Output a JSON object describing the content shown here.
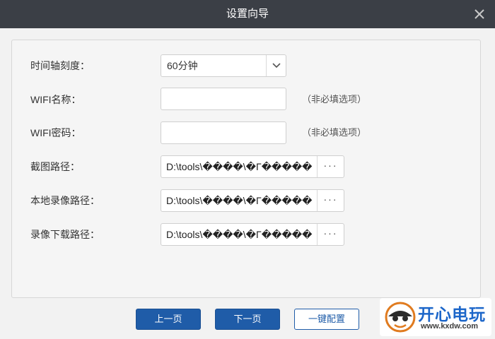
{
  "window": {
    "title": "设置向导"
  },
  "form": {
    "timeline_label": "时间轴刻度：",
    "timeline_value": "60分钟",
    "wifi_name_label": "WIFI名称：",
    "wifi_name_value": "",
    "wifi_name_hint": "（非必填选项）",
    "wifi_password_label": "WIFI密码：",
    "wifi_password_value": "",
    "wifi_password_hint": "（非必填选项）",
    "screenshot_path_label": "截图路径：",
    "screenshot_path_value": "D:\\tools\\����\\�Γ�����",
    "local_record_path_label": "本地录像路径：",
    "local_record_path_value": "D:\\tools\\����\\�Γ�����",
    "record_download_path_label": "录像下载路径：",
    "record_download_path_value": "D:\\tools\\����\\�Γ�����",
    "browse_label": "···"
  },
  "footer": {
    "prev_label": "上一页",
    "next_label": "下一页",
    "one_click_label": "一键配置"
  },
  "watermark": {
    "brand_cn": "开心电玩",
    "url": "www.kxdw.com"
  },
  "colors": {
    "titlebar": "#3b3f46",
    "primary": "#1f5ca8",
    "brand": "#1c66c9"
  }
}
